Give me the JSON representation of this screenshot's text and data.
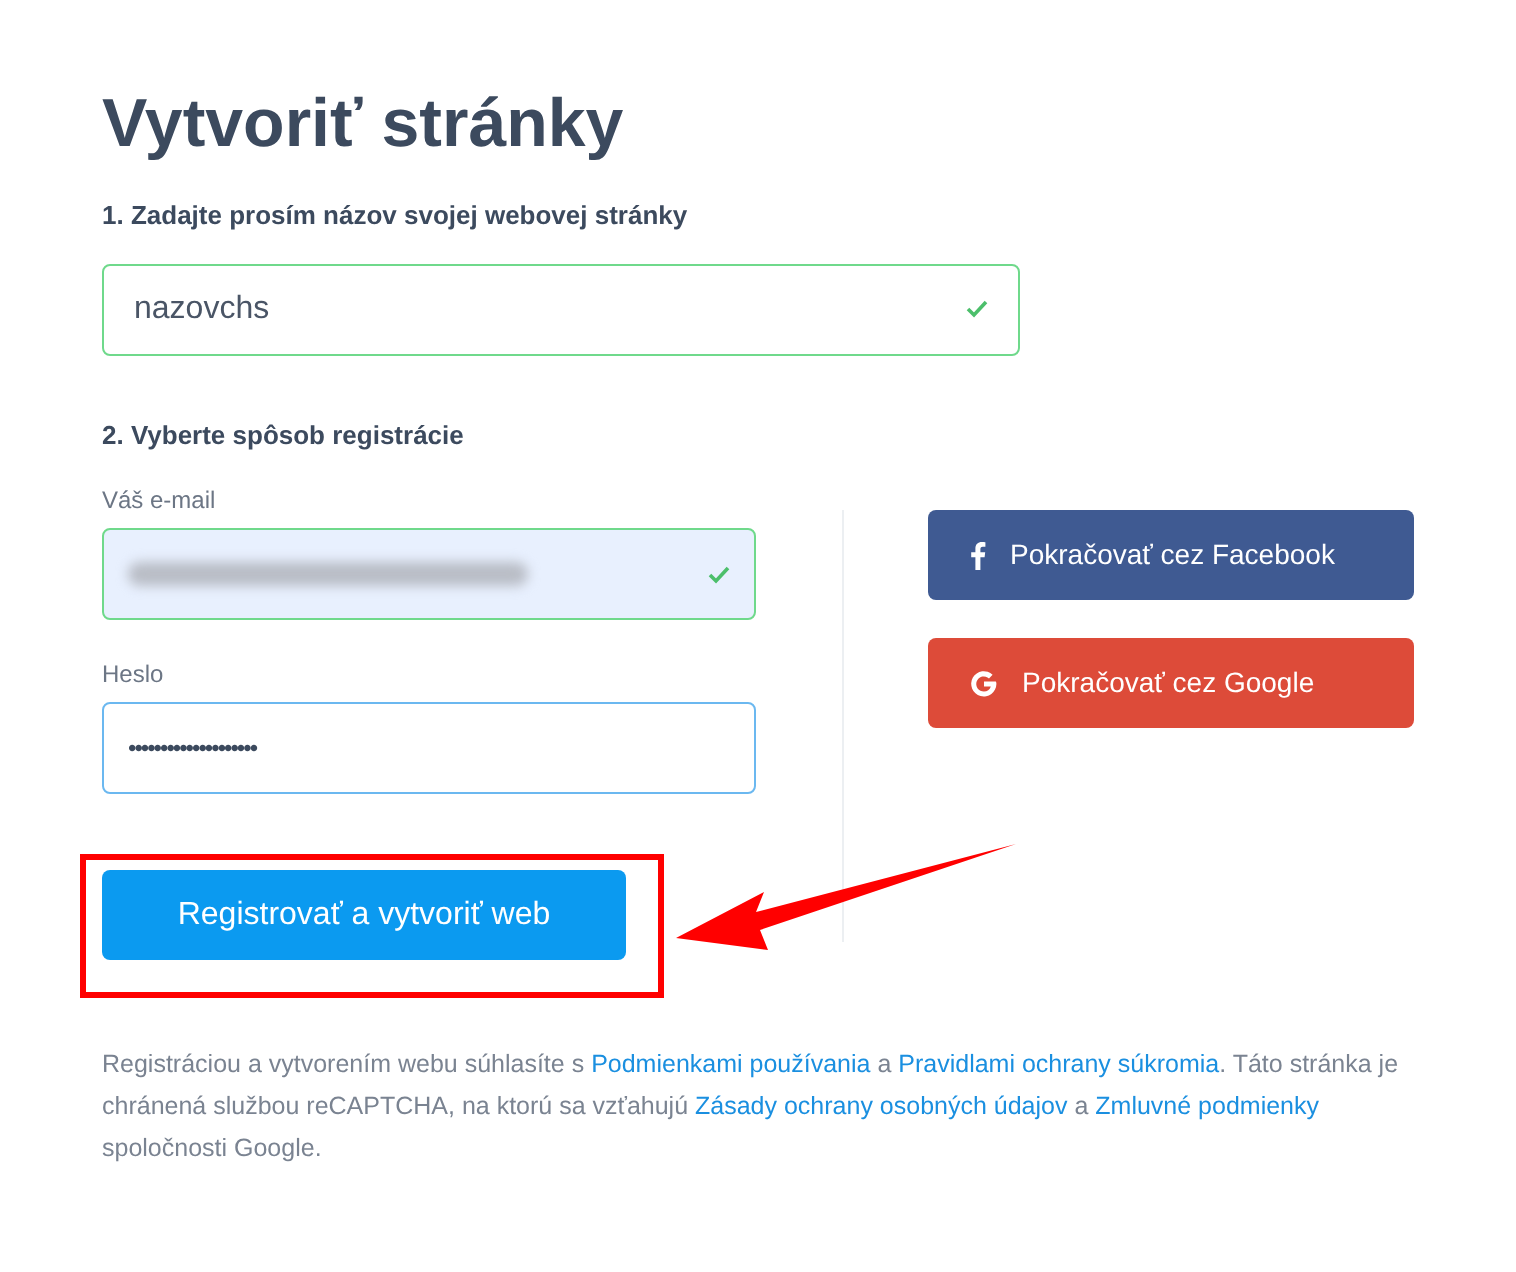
{
  "title": "Vytvoriť stránky",
  "step_1": {
    "label": "1. Zadajte prosím názov svojej webovej stránky",
    "value": "nazovchs",
    "valid": true
  },
  "step_2": {
    "label": "2. Vyberte spôsob registrácie",
    "email": {
      "label": "Váš e-mail",
      "valid": true,
      "redacted": true
    },
    "password": {
      "label": "Heslo",
      "value": "••••••••••••••••••••",
      "focused": true
    },
    "submit": "Registrovať a vytvoriť web",
    "social_buttons": [
      {
        "kind": "facebook",
        "label": "Pokračovať cez Facebook",
        "color": "#3f5a92"
      },
      {
        "kind": "google",
        "label": "Pokračovať cez Google",
        "color": "#dd4b39"
      }
    ]
  },
  "legal": [
    {
      "kind": "text",
      "text": "Registráciou a vytvorením webu súhlasíte s "
    },
    {
      "kind": "link",
      "text": "Podmienkami používania"
    },
    {
      "kind": "text",
      "text": " a "
    },
    {
      "kind": "link",
      "text": "Pravidlami ochrany súkromia"
    },
    {
      "kind": "text",
      "text": ". Táto stránka je chránená službou reCAPTCHA, na ktorú sa vzťahujú "
    },
    {
      "kind": "link",
      "text": "Zásady ochrany osobných údajov"
    },
    {
      "kind": "text",
      "text": " a "
    },
    {
      "kind": "link",
      "text": "Zmluvné podmienky"
    },
    {
      "kind": "text",
      "text": " spoločnosti Google."
    }
  ]
}
